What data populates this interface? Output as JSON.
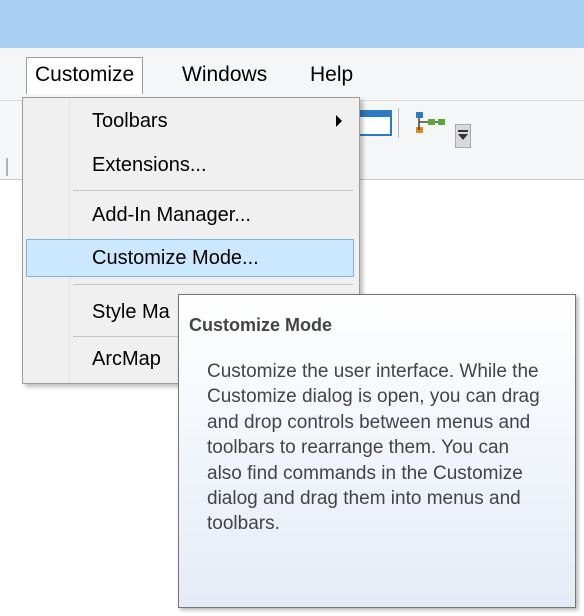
{
  "menubar": {
    "items": [
      {
        "label": "Customize",
        "active": true
      },
      {
        "label": "Windows",
        "active": false
      },
      {
        "label": "Help",
        "active": false
      }
    ]
  },
  "toolbar": {
    "icons": [
      "window-icon",
      "graph-tree-icon",
      "toolbar-overflow-icon"
    ]
  },
  "dropdown": {
    "items": [
      {
        "label": "Toolbars",
        "has_submenu": true
      },
      {
        "label": "Extensions..."
      },
      {
        "label": "Add-In Manager..."
      },
      {
        "label": "Customize Mode...",
        "highlighted": true
      },
      {
        "label": "Style Ma"
      },
      {
        "label": "ArcMap"
      }
    ]
  },
  "tooltip": {
    "title": "Customize Mode",
    "body": "Customize the user interface. While the Customize dialog is open, you can drag and drop controls between menus and toolbars to rearrange them. You can also find commands in the Customize dialog and drag them into menus and toolbars."
  },
  "colors": {
    "titlebar": "#a7d0f3",
    "highlight_bg": "#cce8ff",
    "highlight_border": "#7eb4ea"
  }
}
